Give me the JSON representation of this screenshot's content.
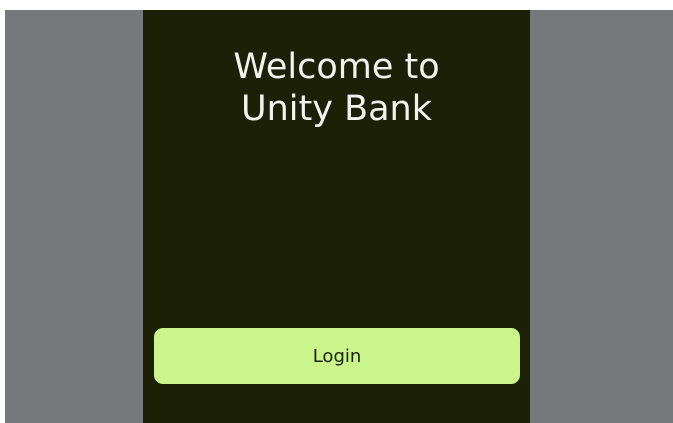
{
  "screen": {
    "title_line1": "Welcome to",
    "title_line2": "Unity Bank",
    "login_label": "Login"
  },
  "colors": {
    "outer_background": "#77787b",
    "screen_background": "#1b2007",
    "title_text": "#f2f2ee",
    "button_background": "#c9f58c",
    "button_text": "#1b2007"
  }
}
